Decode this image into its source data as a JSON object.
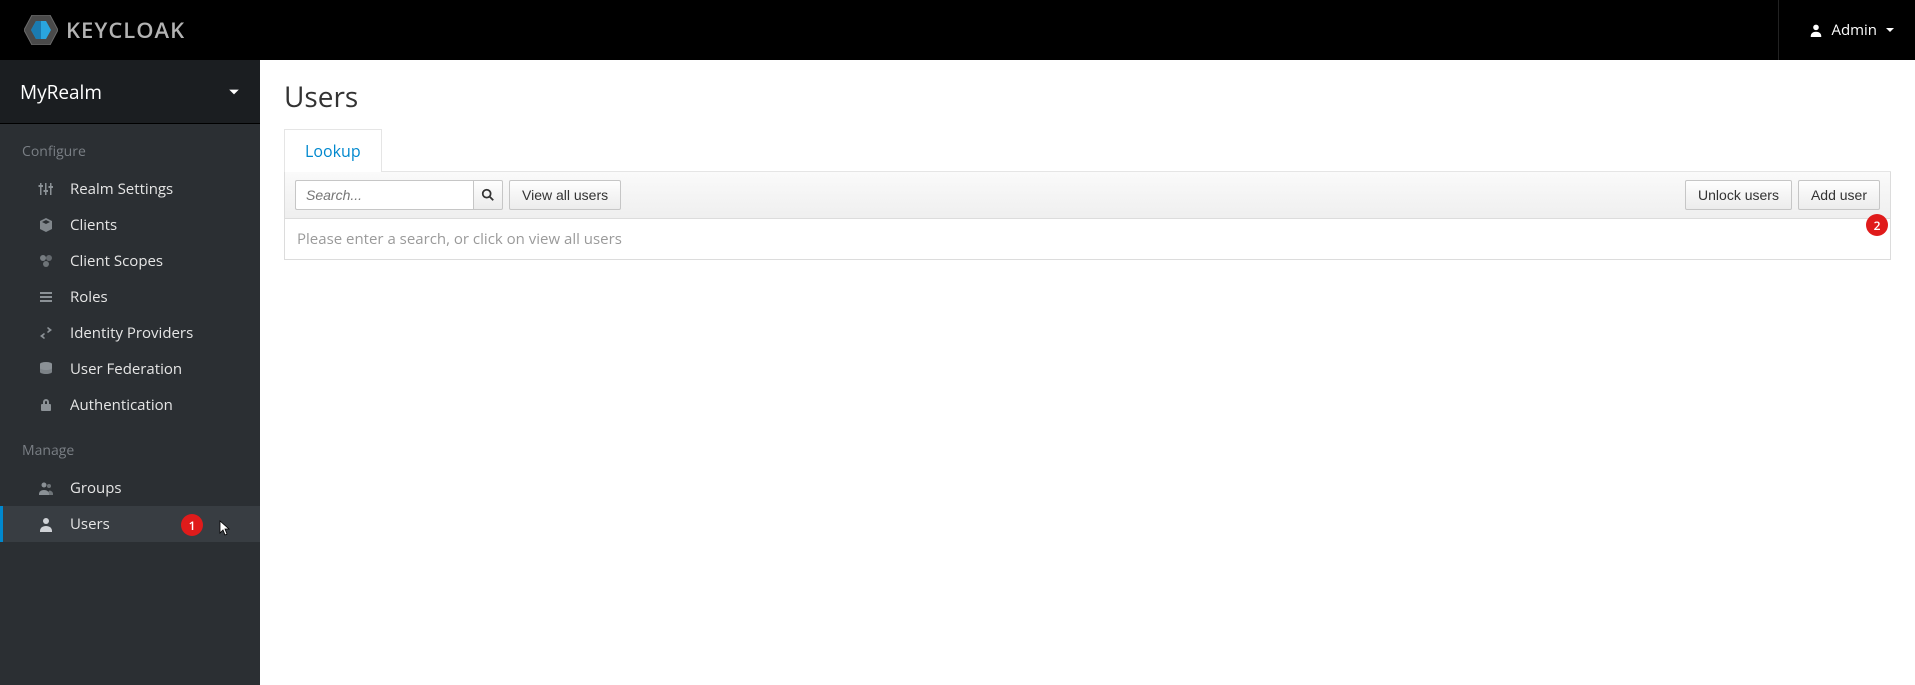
{
  "header": {
    "brand": "KEYCLOAK",
    "user_label": "Admin"
  },
  "sidebar": {
    "realm": "MyRealm",
    "sections": [
      {
        "title": "Configure",
        "items": [
          {
            "label": "Realm Settings",
            "icon": "sliders-icon"
          },
          {
            "label": "Clients",
            "icon": "cube-icon"
          },
          {
            "label": "Client Scopes",
            "icon": "scopes-icon"
          },
          {
            "label": "Roles",
            "icon": "list-icon"
          },
          {
            "label": "Identity Providers",
            "icon": "exchange-icon"
          },
          {
            "label": "User Federation",
            "icon": "database-icon"
          },
          {
            "label": "Authentication",
            "icon": "lock-icon"
          }
        ]
      },
      {
        "title": "Manage",
        "items": [
          {
            "label": "Groups",
            "icon": "group-icon"
          },
          {
            "label": "Users",
            "icon": "user-icon",
            "active": true
          }
        ]
      }
    ]
  },
  "main": {
    "title": "Users",
    "tabs": [
      {
        "label": "Lookup",
        "active": true
      }
    ],
    "toolbar": {
      "search_placeholder": "Search...",
      "view_all_label": "View all users",
      "unlock_label": "Unlock users",
      "add_label": "Add user"
    },
    "empty_message": "Please enter a search, or click on view all users"
  },
  "callouts": {
    "one": "1",
    "two": "2"
  }
}
